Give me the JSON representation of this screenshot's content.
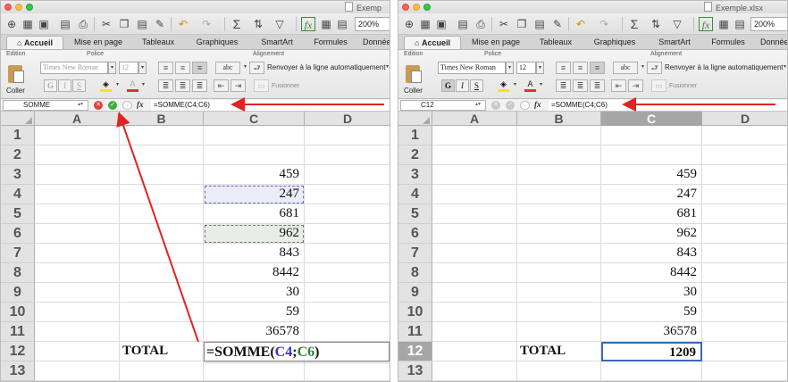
{
  "colors": {
    "annotation_red": "#e02424",
    "ref_blue": "#3535c8",
    "ref_green": "#2e7d32",
    "active_border": "#3a6bb5"
  },
  "toolbar": {
    "icons": [
      "new-sheet-icon",
      "open-icon",
      "save-icon",
      "print-icon",
      "cut-icon",
      "copy-icon",
      "paste-icon",
      "format-painter-icon",
      "undo-icon",
      "redo-icon",
      "autosum-icon",
      "sort-icon",
      "filter-icon",
      "formula-builder-icon",
      "gallery-icon"
    ],
    "zoom": "200%"
  },
  "ribbon": {
    "tabs": [
      "Accueil",
      "Mise en page",
      "Tableaux",
      "Graphiques",
      "SmartArt",
      "Formules",
      "Données"
    ],
    "groups": {
      "edition": "Edition",
      "police": "Police",
      "alignement": "Alignement"
    },
    "paste_label": "Coller",
    "font_name": "Times New Roman",
    "font_size": "12",
    "format_buttons": [
      "G",
      "I",
      "S"
    ],
    "wrap_button": "abc",
    "wrap_text": "Renvoyer à la ligne automatiquement",
    "merge_text": "Fusionner"
  },
  "left": {
    "window_title": "Exemp",
    "namebox": "SOMME",
    "formula": "=SOMME(C4;C6)",
    "formula_cell": {
      "prefix": "=SOMME(",
      "ref1": "C4",
      "sep": ";",
      "ref2": "C6",
      "suffix": ")"
    }
  },
  "right": {
    "window_title": "Exemple.xlsx",
    "namebox": "C12",
    "formula": "=SOMME(C4;C6)",
    "result": "1209"
  },
  "sheet": {
    "columns": [
      "A",
      "B",
      "C",
      "D"
    ],
    "rows": [
      "1",
      "2",
      "3",
      "4",
      "5",
      "6",
      "7",
      "8",
      "9",
      "10",
      "11",
      "12",
      "13"
    ],
    "values_c": [
      "",
      "",
      "459",
      "247",
      "681",
      "962",
      "843",
      "8442",
      "30",
      "59",
      "36578"
    ],
    "total_label": "TOTAL"
  }
}
